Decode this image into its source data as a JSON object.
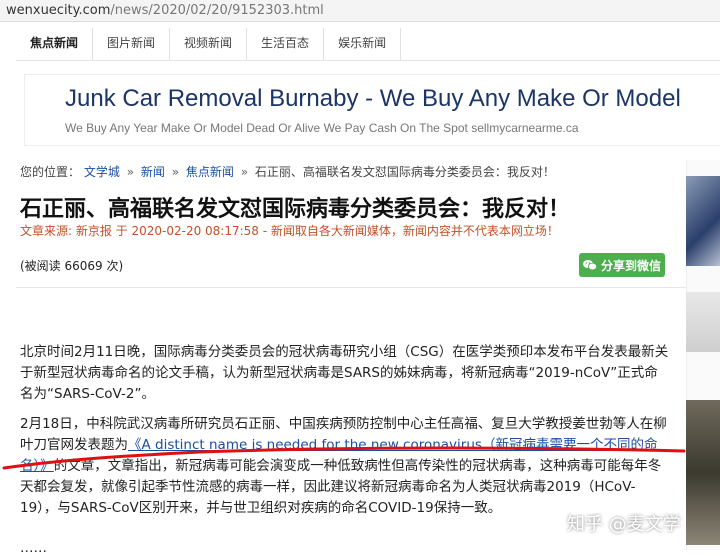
{
  "browser": {
    "url_host": "wenxuecity.com",
    "url_path": "/news/2020/02/20/9152303.html"
  },
  "nav": {
    "items": [
      "焦点新闻",
      "图片新闻",
      "视频新闻",
      "生活百态",
      "娱乐新闻"
    ]
  },
  "ad": {
    "title": "Junk Car Removal Burnaby - We Buy Any Make Or Model",
    "subtitle": "We Buy Any Year Make Or Model Dead Or Alive We Pay Cash On The Spot sellmycarnearme.ca"
  },
  "breadcrumb": {
    "prefix": "您的位置：",
    "items": [
      "文学城",
      "新闻",
      "焦点新闻"
    ],
    "separator": "»",
    "current": "石正丽、高福联名发文怼国际病毒分类委员会：我反对！"
  },
  "article": {
    "title": "石正丽、高福联名发文怼国际病毒分类委员会：我反对！",
    "meta": "文章来源: 新京报 于 2020-02-20 08:17:58 - 新闻取自各大新闻媒体，新闻内容并不代表本网立场！",
    "reads": "(被阅读 66069 次)",
    "share_label": "分享到微信",
    "p1": "北京时间2月11日晚，国际病毒分类委员会的冠状病毒研究小组（CSG）在医学类预印本发布平台发表最新关于新型冠状病毒命名的论文手稿，认为新型冠状病毒是SARS的姊妹病毒，将新冠病毒“2019-nCoV”正式命名为“SARS-CoV-2”。",
    "p2_before": "2月18日，中科院武汉病毒所研究员石正丽、中国疾病预防控制中心主任高福、复旦大学教授姜世勃等人在柳叶刀官网发表题为",
    "p2_link": "《A distinct name is needed for the new coronavirus（新冠病毒需要一个不同的命名）》",
    "p2_after": "的文章，文章指出，新冠病毒可能会演变成一种低致病性但高传染性的冠状病毒，这种病毒可能每年冬天都会复发，就像引起季节性流感的病毒一样，因此建议将新冠病毒命名为人类冠状病毒2019（HCoV-19），与SARS-CoV区别开来，并与世卫组织对疾病的命名COVID-19保持一致。",
    "p3_partial": "……"
  },
  "watermark": "知乎 @麦文学",
  "colors": {
    "link": "#1b4ea1",
    "meta": "#c4502a",
    "share_bg": "#4cae4c",
    "annotation": "#e01010"
  }
}
